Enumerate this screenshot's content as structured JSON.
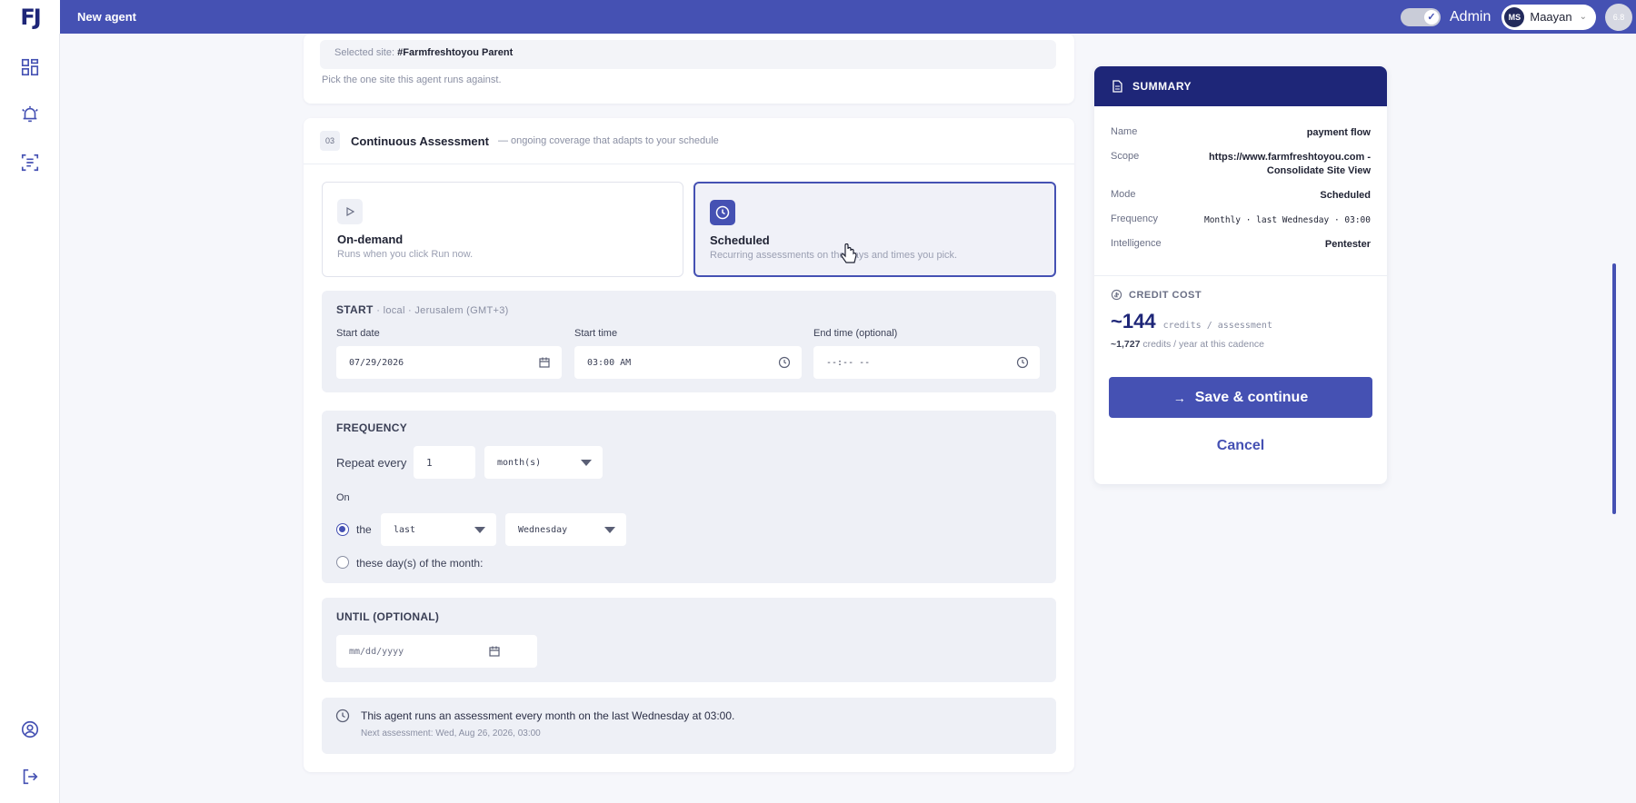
{
  "app": {
    "logo": "FJ",
    "title": "New agent",
    "admin_label": "Admin",
    "user_initials": "MS",
    "user_name": "Maayan",
    "version": "6.8"
  },
  "site": {
    "selected_prefix": "Selected site:",
    "selected_value": "#Farmfreshtoyou Parent",
    "hint": "Pick the one site this agent runs against."
  },
  "assessment": {
    "number": "03",
    "title": "Continuous Assessment",
    "subtitle": "— ongoing coverage that adapts to your schedule",
    "options": [
      {
        "title": "On-demand",
        "desc": "Runs when you click Run now."
      },
      {
        "title": "Scheduled",
        "desc": "Recurring assessments on the days and times you pick."
      }
    ]
  },
  "start": {
    "label": "START",
    "tz": "· local · Jerusalem (GMT+3)",
    "start_date_label": "Start date",
    "start_date_value": "07/29/2026",
    "start_time_label": "Start time",
    "start_time_value": "03:00 AM",
    "end_time_label": "End time (optional)",
    "end_time_value": "--:-- --"
  },
  "frequency": {
    "label": "FREQUENCY",
    "repeat_label": "Repeat every",
    "repeat_value": "1",
    "unit_value": "month(s)",
    "on_label": "On",
    "the_label": "the",
    "ordinal_value": "last",
    "weekday_value": "Wednesday",
    "days_label": "these day(s) of the month:"
  },
  "until": {
    "label": "UNTIL (OPTIONAL)",
    "placeholder": "mm/dd/yyyy"
  },
  "info": {
    "text": "This agent runs an assessment every month on the last Wednesday at 03:00.",
    "next": "Next assessment: Wed, Aug 26, 2026, 03:00"
  },
  "summary": {
    "title": "SUMMARY",
    "name_key": "Name",
    "name_val": "payment flow",
    "scope_key": "Scope",
    "scope_val_1": "https://www.farmfreshtoyou.com -",
    "scope_val_2": "Consolidate Site View",
    "mode_key": "Mode",
    "mode_val": "Scheduled",
    "freq_key": "Frequency",
    "freq_val": "Monthly · last Wednesday · 03:00",
    "intel_key": "Intelligence",
    "intel_val": "Pentester",
    "credit_label": "CREDIT COST",
    "credit_value": "~144",
    "credit_unit": "credits / assessment",
    "yearly_value": "~1,727",
    "yearly_text": "credits / year at this cadence",
    "save_label": "Save & continue",
    "cancel_label": "Cancel"
  },
  "colors": {
    "accent": "#4551b3",
    "header_dark": "#1e2678"
  }
}
